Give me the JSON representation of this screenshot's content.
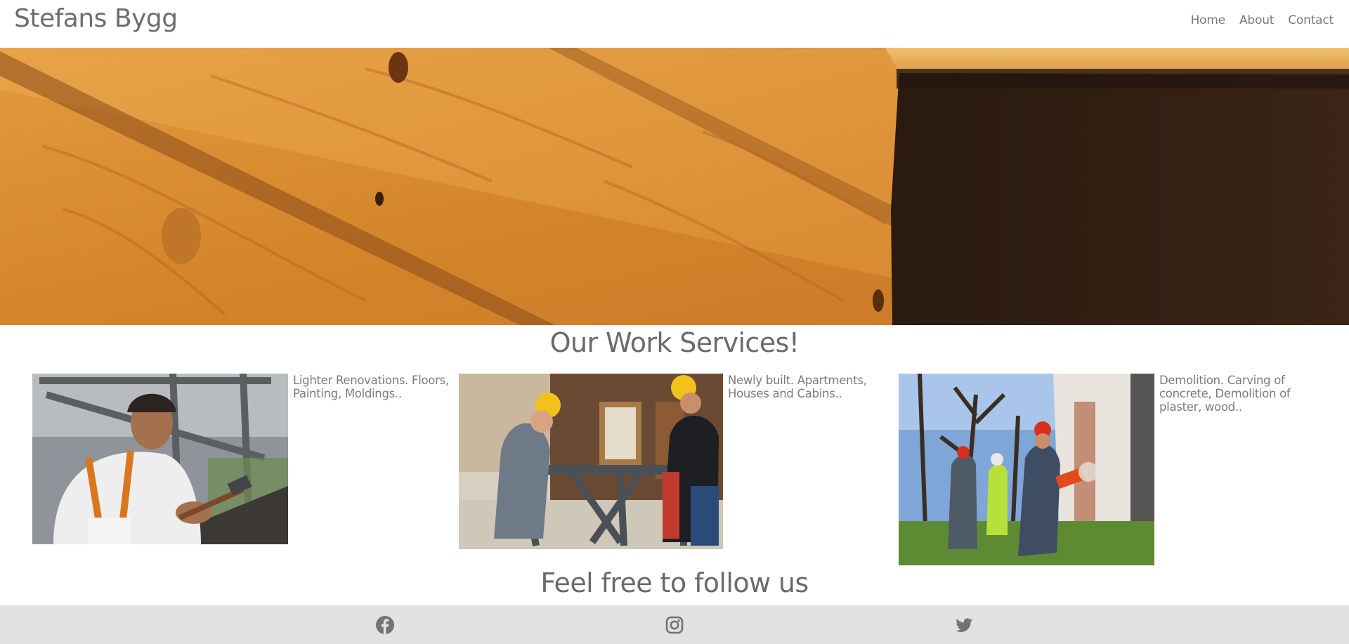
{
  "header": {
    "brand": "Stefans Bygg",
    "nav": [
      "Home",
      "About",
      "Contact"
    ]
  },
  "hero": {
    "image": "wood-planks-photo"
  },
  "services": {
    "title": "Our Work Services!",
    "items": [
      {
        "image": "carpenter-hammer-photo",
        "text": "Lighter Renovations. Floors, Painting, Moldings.."
      },
      {
        "image": "workers-building-cabin-photo",
        "text": "Newly built. Apartments, Houses and Cabins.."
      },
      {
        "image": "demolition-chainsaw-photo",
        "text": "Demolition. Carving of concrete, Demolition of plaster, wood.."
      }
    ]
  },
  "follow": {
    "title": "Feel free to follow us",
    "icons": [
      "facebook-icon",
      "instagram-icon",
      "twitter-icon"
    ]
  },
  "colors": {
    "text": "#6f6f6f",
    "footer_bg": "#e2e2e2",
    "wood": "#d98a2c"
  }
}
